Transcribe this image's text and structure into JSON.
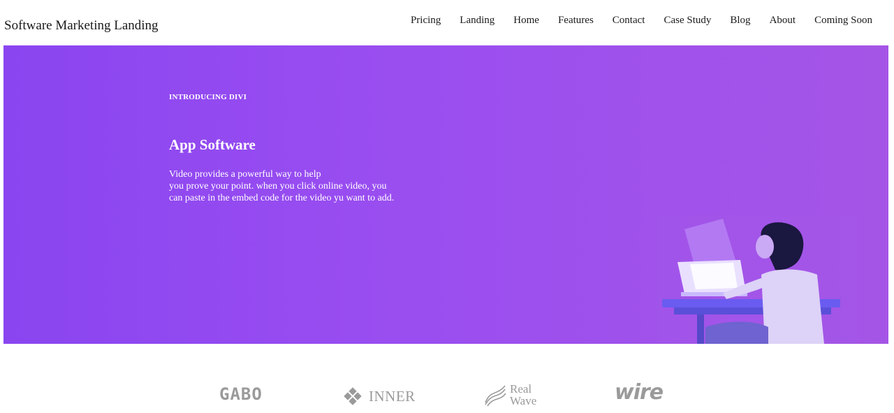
{
  "header": {
    "site_title": "Software Marketing Landing",
    "nav": [
      "Pricing",
      "Landing",
      "Home",
      "Features",
      "Contact",
      "Case Study",
      "Blog",
      "About",
      "Coming Soon"
    ]
  },
  "hero": {
    "kicker": "INTRODUCING DIVI",
    "title": "App Software",
    "body_lines": [
      "Video provides a powerful way to help",
      "you prove your point. when you click online video, you",
      "can paste in the embed code for the video yu want to add."
    ],
    "gradient_colors": [
      "#8a45f0",
      "#a555e6"
    ]
  },
  "logos": {
    "gabo": "GABO",
    "inner": "INNER",
    "realwave_line1": "Real",
    "realwave_line2": "Wave",
    "wire": "wire"
  }
}
